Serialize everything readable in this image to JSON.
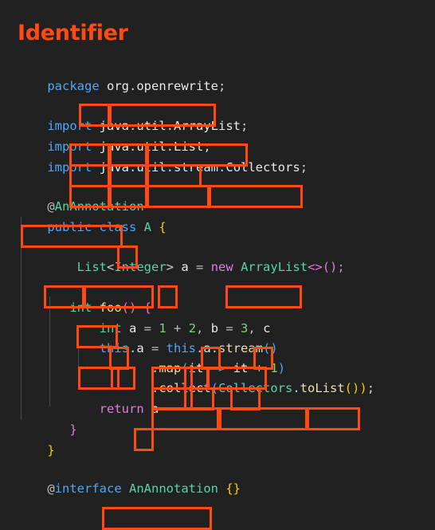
{
  "title": "Identifier",
  "accent_color": "#FF4A14",
  "background_color": "#212121",
  "code": {
    "language": "java",
    "lines": [
      {
        "n": 1,
        "text": "package org.openrewrite;"
      },
      {
        "n": 2,
        "text": ""
      },
      {
        "n": 3,
        "text": "import java.util.ArrayList;"
      },
      {
        "n": 4,
        "text": "import java.util.List;"
      },
      {
        "n": 5,
        "text": "import java.util.stream.Collectors;"
      },
      {
        "n": 6,
        "text": ""
      },
      {
        "n": 7,
        "text": "@AnAnnotation"
      },
      {
        "n": 8,
        "text": "public class A {"
      },
      {
        "n": 9,
        "text": ""
      },
      {
        "n": 10,
        "text": "    List<Integer> a = new ArrayList<>();"
      },
      {
        "n": 11,
        "text": ""
      },
      {
        "n": 12,
        "text": "    int foo() {"
      },
      {
        "n": 13,
        "text": "        int a = 1 + 2, b = 3, c"
      },
      {
        "n": 14,
        "text": "        this.a = this.a.stream()"
      },
      {
        "n": 15,
        "text": "                .map(it -> it + 1)"
      },
      {
        "n": 16,
        "text": "                .collect(Collectors.toList()));"
      },
      {
        "n": 17,
        "text": "        return a"
      },
      {
        "n": 18,
        "text": "    }"
      },
      {
        "n": 19,
        "text": "}"
      },
      {
        "n": 20,
        "text": ""
      },
      {
        "n": 21,
        "text": "@interface AnAnnotation {}"
      }
    ]
  },
  "highlights": {
    "label": "Identifier",
    "count": 29,
    "tokens": [
      "org",
      "openrewrite;",
      "java",
      "util",
      "ArrayList;",
      "java",
      "util",
      "List;",
      "java",
      "util",
      "stream",
      "Collectors;",
      "AnAnnotation",
      "A",
      "List",
      "Integer",
      "a",
      "ArrayList",
      "foo",
      "a",
      "b",
      "c",
      "this",
      "a",
      "this",
      "a",
      "stream",
      "map",
      "it",
      "it",
      "collect",
      "Collectors",
      "toList",
      "a",
      "AnAnnotation"
    ]
  }
}
